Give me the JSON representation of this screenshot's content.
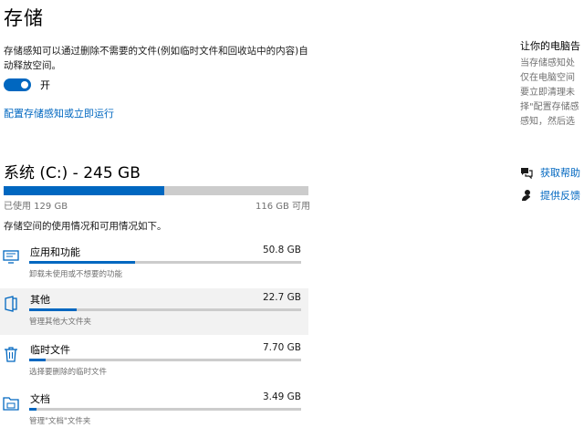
{
  "page": {
    "title": "存储",
    "description": "存储感知可以通过删除不需要的文件(例如临时文件和回收站中的内容)自动释放空间。",
    "toggle_label": "开",
    "toggle_on": true,
    "configure_link": "配置存储感知或立即运行"
  },
  "drive": {
    "title": "系统 (C:) - 245 GB",
    "used_label": "已使用 129 GB",
    "free_label": "116 GB 可用",
    "used_fraction": 0.527,
    "info": "存储空间的使用情况和可用情况如下。"
  },
  "categories": [
    {
      "name": "应用和功能",
      "size": "50.8 GB",
      "sub": "卸载未使用或不想要的功能",
      "fraction": 0.39,
      "icon": "monitor-icon"
    },
    {
      "name": "其他",
      "size": "22.7 GB",
      "sub": "管理其他大文件夹",
      "fraction": 0.176,
      "icon": "folder-open-icon"
    },
    {
      "name": "临时文件",
      "size": "7.70 GB",
      "sub": "选择要删除的临时文件",
      "fraction": 0.06,
      "icon": "trash-icon"
    },
    {
      "name": "文档",
      "size": "3.49 GB",
      "sub": "管理\"文档\"文件夹",
      "fraction": 0.027,
      "icon": "documents-folder-icon"
    }
  ],
  "sidebar": {
    "title": "让你的电脑告",
    "text_lines": [
      "当存储感知处",
      "仅在电脑空间",
      "要立即清理未",
      "择\"配置存储感",
      "感知，然后选"
    ],
    "help_link": "获取帮助",
    "feedback_link": "提供反馈"
  },
  "colors": {
    "accent": "#0067c0",
    "track": "#cccccc",
    "highlight": "#f2f2f2"
  }
}
